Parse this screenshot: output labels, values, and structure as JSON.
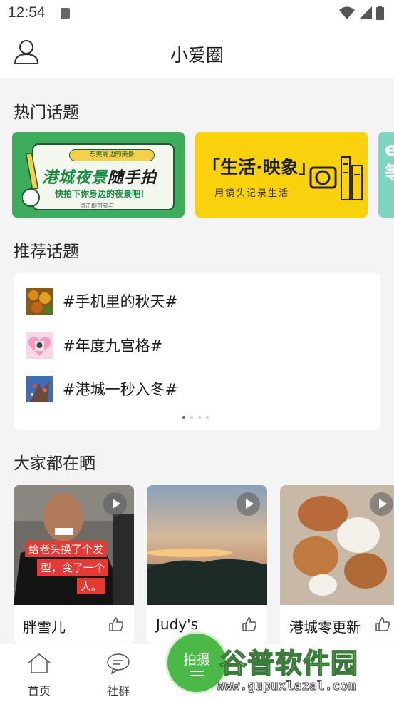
{
  "status_bar": {
    "time": "12:54"
  },
  "header": {
    "title": "小爱圈"
  },
  "sections": {
    "hot_topics": "热门话题",
    "recommended_topics": "推荐话题",
    "everyone_shares": "大家都在晒"
  },
  "banners": [
    {
      "tag": "东莞周边的美景",
      "title_green": "港城夜景",
      "title_black": "随手拍",
      "subtitle": "快拍下你身边的夜景吧！",
      "hint": "点击即可参与",
      "bg": "#3ead5b"
    },
    {
      "title": "「生活·映象」",
      "subtitle": "用镜头记录生活",
      "bg": "#f9d10c"
    },
    {
      "text": "e 等",
      "bg": "#7ed5c0"
    }
  ],
  "recommended": [
    {
      "label": "#手机里的秋天#",
      "thumb": "autumn-leaves"
    },
    {
      "label": "#年度九宫格#",
      "thumb": "heart-portrait"
    },
    {
      "label": "#港城一秒入冬#",
      "thumb": "winter-tree"
    }
  ],
  "pagination": {
    "total": 4,
    "active": 0
  },
  "posts": [
    {
      "name": "胖雪儿",
      "video": true,
      "caption": [
        "给老头换了个发",
        "型，变了一个",
        "人。"
      ]
    },
    {
      "name": "Judy's",
      "video": true
    },
    {
      "name": "港城零更新",
      "video": true
    }
  ],
  "tabbar": {
    "home": "首页",
    "community": "社群",
    "shoot": "拍摄"
  },
  "watermark": {
    "big": "谷普软件园",
    "small": "www.gupuxlazal.com"
  },
  "colors": {
    "accent": "#4cb848",
    "caption_red": "#e53935"
  }
}
